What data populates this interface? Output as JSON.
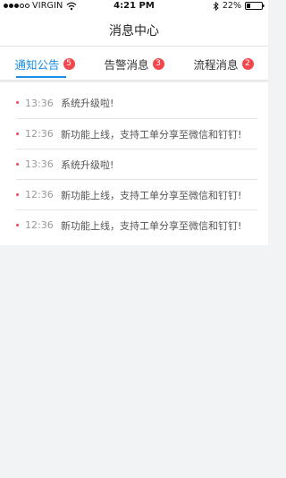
{
  "status_bar": {
    "carrier": "VIRGIN",
    "time": "4:21 PM",
    "battery": "22%"
  },
  "header": {
    "title": "消息中心"
  },
  "tabs": [
    {
      "label": "通知公告",
      "badge": "5",
      "active": true
    },
    {
      "label": "告警消息",
      "badge": "3",
      "active": false
    },
    {
      "label": "流程消息",
      "badge": "2",
      "active": false
    }
  ],
  "colors": {
    "accent": "#1a8ee8",
    "badge": "#f2474d"
  },
  "messages": [
    {
      "time": "13:36",
      "text": "系统升级啦!"
    },
    {
      "time": "12:36",
      "text": "新功能上线，支持工单分享至微信和钉钉!"
    },
    {
      "time": "13:36",
      "text": "系统升级啦!"
    },
    {
      "time": "12:36",
      "text": "新功能上线，支持工单分享至微信和钉钉!"
    },
    {
      "time": "12:36",
      "text": "新功能上线，支持工单分享至微信和钉钉!"
    }
  ]
}
